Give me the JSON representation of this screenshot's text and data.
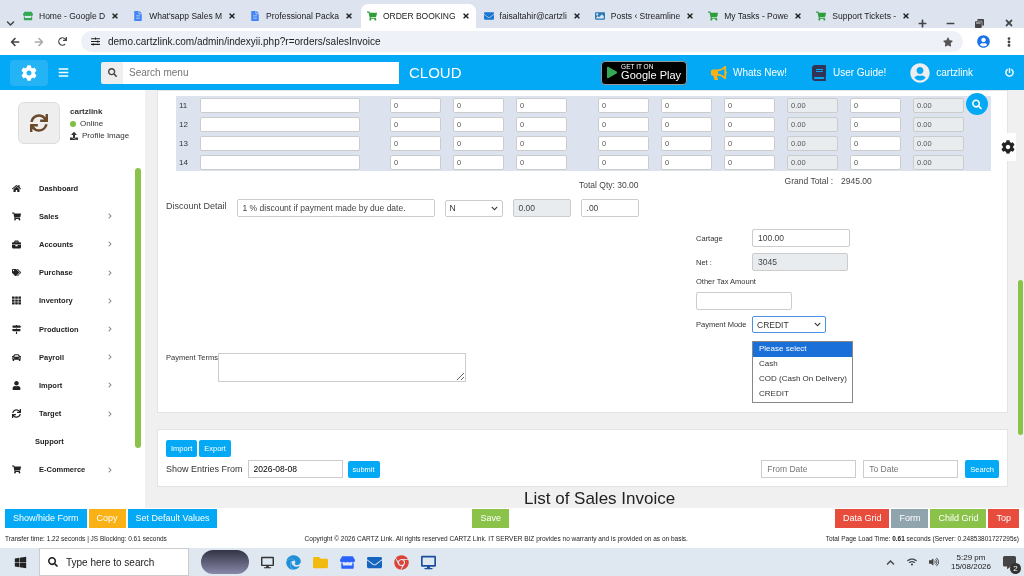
{
  "browser": {
    "tabs": [
      {
        "title": "Home - Google D",
        "selected": false
      },
      {
        "title": "What'sapp Sales M",
        "selected": false
      },
      {
        "title": "Professional Packa",
        "selected": false
      },
      {
        "title": "ORDER BOOKING",
        "selected": true
      },
      {
        "title": "faisaltahir@cartzli",
        "selected": false
      },
      {
        "title": "Posts ‹ Streamline",
        "selected": false
      },
      {
        "title": "My Tasks - Powe",
        "selected": false
      },
      {
        "title": "Support Tickets -",
        "selected": false
      }
    ],
    "url": "demo.cartzlink.com/admin/indexyii.php?r=orders/salesInvoice"
  },
  "header": {
    "search_placeholder": "Search menu",
    "brand": "CLOUD",
    "store_small": "GET IT ON",
    "store_big": "Google Play",
    "whats_new": "Whats New!",
    "user_guide": "User Guide!",
    "user": "cartzlink"
  },
  "sidebar": {
    "user": "cartzlink",
    "status": "Online",
    "profile_link": "Profile Image",
    "items": [
      {
        "label": "Dashboard",
        "kind": "module",
        "has_submenu": false
      },
      {
        "label": "Sales",
        "kind": "module",
        "has_submenu": true
      },
      {
        "label": "Accounts",
        "kind": "module",
        "has_submenu": true
      },
      {
        "label": "Purchase",
        "kind": "module",
        "has_submenu": true
      },
      {
        "label": "Inventory",
        "kind": "module",
        "has_submenu": true
      },
      {
        "label": "Production",
        "kind": "module",
        "has_submenu": true
      },
      {
        "label": "Payroll",
        "kind": "module",
        "has_submenu": true
      },
      {
        "label": "Import",
        "kind": "module",
        "has_submenu": true
      },
      {
        "label": "Target",
        "kind": "module",
        "has_submenu": true
      },
      {
        "label": "Support",
        "kind": "plain",
        "has_submenu": false
      },
      {
        "label": "E-Commerce",
        "kind": "module",
        "has_submenu": true
      }
    ]
  },
  "table": {
    "rows": [
      {
        "number": "11",
        "cells": [
          {
            "value": "0",
            "readonly": false
          },
          {
            "value": "0",
            "readonly": false
          },
          {
            "value": "0",
            "readonly": false
          },
          {
            "value": "0",
            "readonly": false
          },
          {
            "value": "0",
            "readonly": false
          },
          {
            "value": "0",
            "readonly": false
          },
          {
            "value": "0.00",
            "readonly": true
          },
          {
            "value": "0",
            "readonly": false
          },
          {
            "value": "0.00",
            "readonly": true
          }
        ]
      },
      {
        "number": "12",
        "cells": [
          {
            "value": "0",
            "readonly": false
          },
          {
            "value": "0",
            "readonly": false
          },
          {
            "value": "0",
            "readonly": false
          },
          {
            "value": "0",
            "readonly": false
          },
          {
            "value": "0",
            "readonly": false
          },
          {
            "value": "0",
            "readonly": false
          },
          {
            "value": "0.00",
            "readonly": true
          },
          {
            "value": "0",
            "readonly": false
          },
          {
            "value": "0.00",
            "readonly": true
          }
        ]
      },
      {
        "number": "13",
        "cells": [
          {
            "value": "0",
            "readonly": false
          },
          {
            "value": "0",
            "readonly": false
          },
          {
            "value": "0",
            "readonly": false
          },
          {
            "value": "0",
            "readonly": false
          },
          {
            "value": "0",
            "readonly": false
          },
          {
            "value": "0",
            "readonly": false
          },
          {
            "value": "0.00",
            "readonly": true
          },
          {
            "value": "0",
            "readonly": false
          },
          {
            "value": "0.00",
            "readonly": true
          }
        ]
      },
      {
        "number": "14",
        "cells": [
          {
            "value": "0",
            "readonly": false
          },
          {
            "value": "0",
            "readonly": false
          },
          {
            "value": "0",
            "readonly": false
          },
          {
            "value": "0",
            "readonly": false
          },
          {
            "value": "0",
            "readonly": false
          },
          {
            "value": "0",
            "readonly": false
          },
          {
            "value": "0.00",
            "readonly": true
          },
          {
            "value": "0",
            "readonly": false
          },
          {
            "value": "0.00",
            "readonly": true
          }
        ]
      }
    ]
  },
  "totals": {
    "total_qty": "Total Qty: 30.00",
    "grand_total_label": "Grand Total :",
    "grand_total": "2945.00"
  },
  "discount": {
    "label": "Discount Detail",
    "detail": "1 % discount if payment made by due date.",
    "flag": "N",
    "amount": "0.00",
    "percent": ".00"
  },
  "summary": {
    "cartage_label": "Cartage",
    "cartage": "100.00",
    "net_label": "Net :",
    "net": "3045",
    "other_tax_label": "Other Tax Amount",
    "payment_mode_label": "Payment Mode",
    "payment_mode": "CREDIT",
    "payment_options": [
      {
        "label": "Please select",
        "selected": true
      },
      {
        "label": "Cash",
        "selected": false
      },
      {
        "label": "COD (Cash On Delivery)",
        "selected": false
      },
      {
        "label": "CREDIT",
        "selected": false
      }
    ]
  },
  "payment_terms_label": "Payment Terms",
  "list": {
    "import": "Import",
    "export": "Export",
    "entries_label": "Show Entries From",
    "entries_date": "2026-08-08",
    "submit": "submit",
    "from_placeholder": "From Date",
    "to_placeholder": "To Date",
    "search": "Search",
    "heading": "List of Sales Invoice"
  },
  "actions": {
    "left": [
      {
        "label": "Show/hide Form",
        "color": "#03a9f4"
      },
      {
        "label": "Copy",
        "color": "#f9b115"
      },
      {
        "label": "Set Default Values",
        "color": "#03a9f4"
      }
    ],
    "save": {
      "label": "Save",
      "color": "#8bc34a"
    },
    "right": [
      {
        "label": "Data Grid",
        "color": "#e74c3c"
      },
      {
        "label": "Form",
        "color": "#90a4ae"
      },
      {
        "label": "Child Grid",
        "color": "#8bc34a"
      },
      {
        "label": "Top",
        "color": "#e74c3c"
      }
    ]
  },
  "footer": {
    "left": "Transfer time: 1.22 seconds | JS Blocking: 0.61 seconds",
    "center": "Copyright © 2026 CARTZ Link. All rights reserved CARTZ Link. IT SERVER BIZ provides no warranty and is provided on as on basis.",
    "right": "Total Page Load Time: **0.61** seconds (Server: 0.24853801727295s)"
  },
  "taskbar": {
    "search_placeholder": "Type here to search",
    "time": "5:29 pm",
    "date": "15/08/2026",
    "notifications": "2"
  }
}
